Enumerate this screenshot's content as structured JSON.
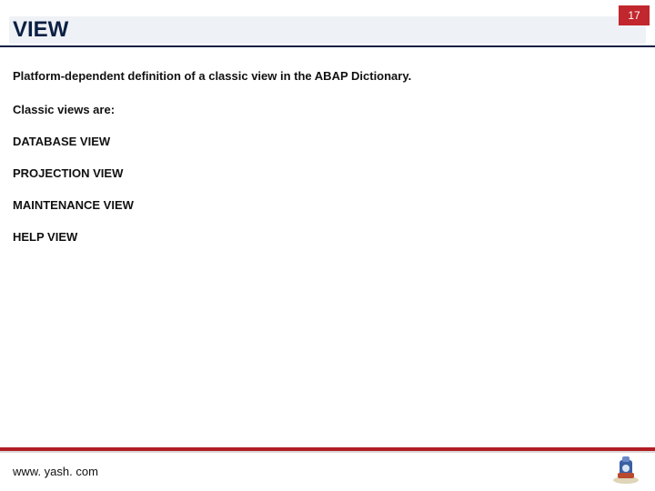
{
  "header": {
    "title": "VIEW",
    "page_number": "17"
  },
  "content": {
    "intro": "Platform-dependent definition of a classic view in the ABAP Dictionary.",
    "list_heading": "Classic views are:",
    "items": [
      "DATABASE VIEW",
      "PROJECTION VIEW",
      "MAINTENANCE VIEW",
      "HELP VIEW"
    ]
  },
  "footer": {
    "url": "www. yash. com"
  }
}
